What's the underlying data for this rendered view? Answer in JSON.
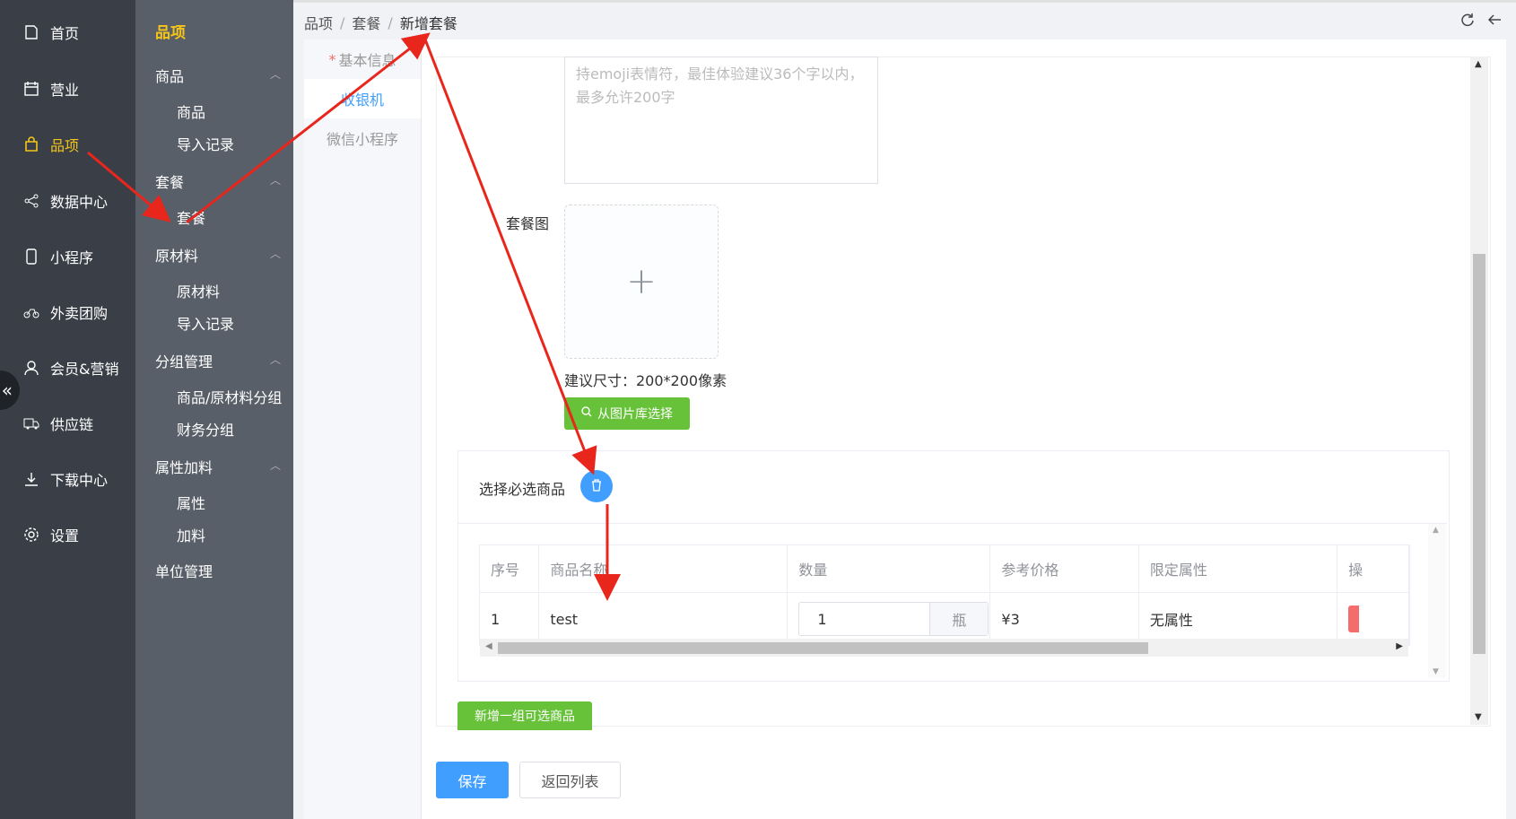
{
  "sidebar": {
    "items": [
      {
        "label": "首页",
        "icon": "home-icon"
      },
      {
        "label": "营业",
        "icon": "calendar-icon"
      },
      {
        "label": "品项",
        "icon": "bag-icon"
      },
      {
        "label": "数据中心",
        "icon": "share-icon"
      },
      {
        "label": "小程序",
        "icon": "phone-icon"
      },
      {
        "label": "外卖团购",
        "icon": "bike-icon"
      },
      {
        "label": "会员&营销",
        "icon": "user-icon"
      },
      {
        "label": "供应链",
        "icon": "truck-icon"
      },
      {
        "label": "下载中心",
        "icon": "download-icon"
      },
      {
        "label": "设置",
        "icon": "gear-icon"
      }
    ],
    "active": "品项",
    "collapse": "«"
  },
  "subnav": {
    "title": "品项",
    "groups": [
      {
        "label": "商品",
        "items": [
          "商品",
          "导入记录"
        ]
      },
      {
        "label": "套餐",
        "items": [
          "套餐"
        ]
      },
      {
        "label": "原材料",
        "items": [
          "原材料",
          "导入记录"
        ]
      },
      {
        "label": "分组管理",
        "items": [
          "商品/原材料分组",
          "财务分组"
        ]
      },
      {
        "label": "属性加料",
        "items": [
          "属性",
          "加料"
        ]
      },
      {
        "label": "单位管理",
        "items": []
      }
    ]
  },
  "breadcrumb": [
    "品项",
    "套餐",
    "新增套餐"
  ],
  "breadcrumb_sep": "/",
  "top_icons": [
    "refresh-icon",
    "back-arrow-icon"
  ],
  "tabs": [
    {
      "label": "基本信息",
      "required": "*"
    },
    {
      "label": "收银机",
      "active": true
    },
    {
      "label": "微信小程序"
    }
  ],
  "form": {
    "desc_placeholder_line1": "持emoji表情符，最佳体验建议36个字以内，",
    "desc_placeholder_line2": "最多允许200字",
    "pic_label": "套餐图",
    "uploader_plus": "+",
    "size_hint": "建议尺寸：200*200像素",
    "library_button": "从图片库选择",
    "group_label": "选择必选商品",
    "table_headers": [
      "序号",
      "商品名称",
      "数量",
      "参考价格",
      "限定属性",
      "操"
    ],
    "table_rows": [
      {
        "index": "1",
        "name": "test",
        "qty": "1",
        "unit": "瓶",
        "price": "¥3",
        "attr": "无属性"
      }
    ],
    "add_group_button": "新增一组可选商品"
  },
  "actions": {
    "save": "保存",
    "back": "返回列表"
  },
  "colors": {
    "sidebar_bg": "#3a3f47",
    "subnav_bg": "#595f68",
    "accent_yellow": "#f5c518",
    "primary": "#409eff",
    "success": "#67c23a",
    "annotation_red": "#e8261c"
  }
}
